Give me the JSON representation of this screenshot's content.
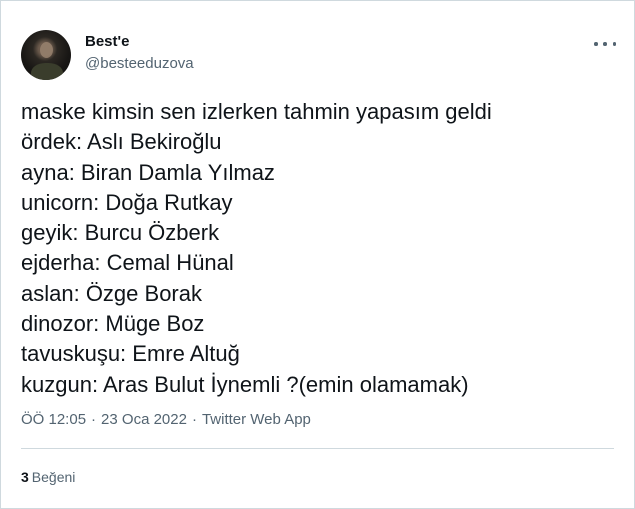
{
  "author": {
    "display_name": "Best'e",
    "handle": "@besteeduzova",
    "avatar_icon": "profile-photo"
  },
  "tweet": {
    "lines": [
      "maske kimsin sen izlerken tahmin yapasım geldi",
      "ördek: Aslı Bekiroğlu",
      "ayna: Biran Damla Yılmaz",
      "unicorn: Doğa Rutkay",
      "geyik: Burcu Özberk",
      "ejderha: Cemal Hünal",
      "aslan: Özge Borak",
      "dinozor: Müge Boz",
      "tavuskuşu: Emre Altuğ",
      "kuzgun: Aras Bulut İynemli ?(emin olamamak)"
    ]
  },
  "meta": {
    "time": "ÖÖ 12:05",
    "separator": "·",
    "date": "23 Oca 2022",
    "source": "Twitter Web App"
  },
  "engagement": {
    "likes_count": "3",
    "likes_label": "Beğeni"
  },
  "colors": {
    "text": "#0f1419",
    "secondary": "#536471",
    "border": "#cfd9de"
  }
}
